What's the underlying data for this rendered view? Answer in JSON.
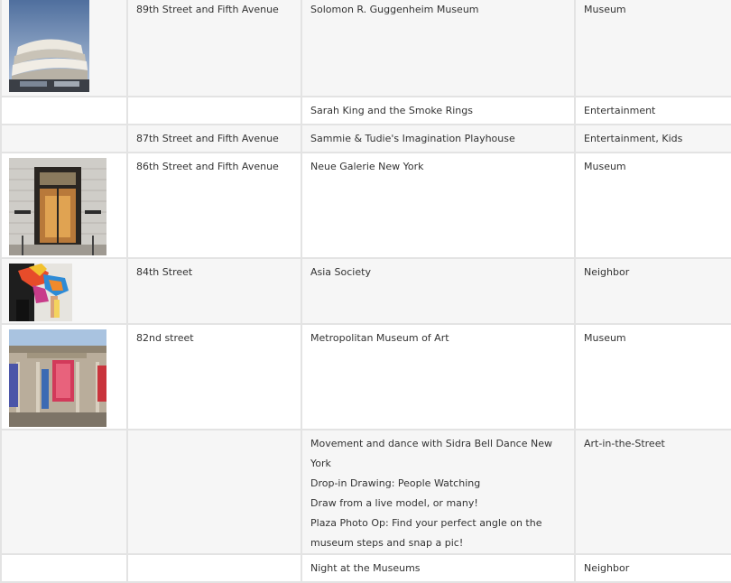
{
  "rows": [
    {
      "location": "89th Street and Fifth Avenue",
      "venue": [
        "Solomon R. Guggenheim Museum"
      ],
      "category": "Museum",
      "image": "guggenheim-museum-photo"
    },
    {
      "location": "",
      "venue": [
        "Sarah King and the Smoke Rings"
      ],
      "category": "Entertainment",
      "image": ""
    },
    {
      "location": "87th Street and Fifth Avenue",
      "venue": [
        "Sammie & Tudie's Imagination Playhouse"
      ],
      "category": "Entertainment, Kids",
      "image": ""
    },
    {
      "location": "86th Street and Fifth Avenue",
      "venue": [
        "Neue Galerie New York"
      ],
      "category": "Museum",
      "image": "neue-galerie-entrance-photo"
    },
    {
      "location": "84th Street",
      "venue": [
        "Asia Society"
      ],
      "category": "Neighbor",
      "image": "asia-society-performer-photo"
    },
    {
      "location": "82nd street",
      "venue": [
        "Metropolitan Museum of Art"
      ],
      "category": "Museum",
      "image": "met-museum-facade-photo"
    },
    {
      "location": "",
      "venue": [
        "Movement and dance with Sidra Bell Dance New York",
        "Drop-in Drawing: People Watching",
        "Draw from a live model, or many!",
        "Plaza Photo Op: Find your perfect angle on the museum steps and snap a pic!"
      ],
      "category": "Art-in-the-Street",
      "image": ""
    },
    {
      "location": "",
      "venue": [
        "Night at the Museums"
      ],
      "category": "Neighbor",
      "image": ""
    }
  ]
}
